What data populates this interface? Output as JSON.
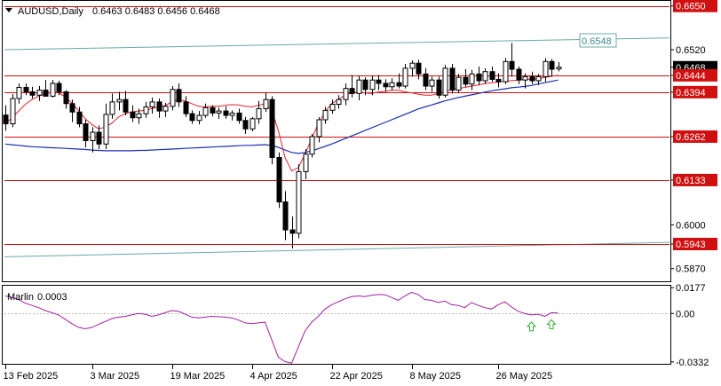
{
  "header": {
    "symbol": "AUDUSD,Daily",
    "ohlc": "0.6463 0.6483 0.6456 0.6468"
  },
  "indicator": {
    "name": "Marlin",
    "value": "0.0003",
    "color": "#a020a0"
  },
  "colors": {
    "bull": "#ffffff",
    "bear": "#000000",
    "ma_red": "#e0202a",
    "ma_blue": "#1a2fb0",
    "level_line": "#d01010",
    "channel": "#6aa8a8",
    "signal_arrow": "#30b030"
  },
  "chart_data": [
    {
      "type": "candlestick",
      "title": "AUDUSD,Daily",
      "ylim": [
        0.5835,
        0.6665
      ],
      "price_ticks": [
        "0.6650",
        "0.6520",
        "0.6468",
        "0.6444",
        "0.6394",
        "0.6262",
        "0.6133",
        "0.6000",
        "0.5943",
        "0.5870"
      ],
      "x_ticks": [
        "13 Feb 2025",
        "3 Mar 2025",
        "19 Mar 2025",
        "4 Apr 2025",
        "22 Apr 2025",
        "8 May 2025",
        "26 May 2025"
      ],
      "levels": [
        0.665,
        0.6444,
        0.6394,
        0.6262,
        0.6133,
        0.5943
      ],
      "channel_label": "0.6548",
      "current_price": "0.6468",
      "candles": [
        [
          0.6326,
          0.6355,
          0.628,
          0.63
        ],
        [
          0.63,
          0.6388,
          0.629,
          0.6375
        ],
        [
          0.6375,
          0.642,
          0.636,
          0.6408
        ],
        [
          0.6408,
          0.642,
          0.6385,
          0.6395
        ],
        [
          0.6395,
          0.641,
          0.6375,
          0.6385
        ],
        [
          0.6385,
          0.6412,
          0.6368,
          0.64
        ],
        [
          0.64,
          0.643,
          0.6385,
          0.6382
        ],
        [
          0.6382,
          0.643,
          0.6378,
          0.642
        ],
        [
          0.642,
          0.6428,
          0.6385,
          0.6395
        ],
        [
          0.6395,
          0.64,
          0.6345,
          0.636
        ],
        [
          0.636,
          0.6372,
          0.6305,
          0.6335
        ],
        [
          0.6335,
          0.635,
          0.629,
          0.63
        ],
        [
          0.63,
          0.6312,
          0.623,
          0.625
        ],
        [
          0.625,
          0.629,
          0.6215,
          0.6275
        ],
        [
          0.6275,
          0.6295,
          0.6225,
          0.624
        ],
        [
          0.624,
          0.636,
          0.6225,
          0.6328
        ],
        [
          0.6328,
          0.639,
          0.6315,
          0.6365
        ],
        [
          0.6365,
          0.6395,
          0.634,
          0.6372
        ],
        [
          0.6372,
          0.6398,
          0.6325,
          0.6335
        ],
        [
          0.6335,
          0.6355,
          0.6305,
          0.6318
        ],
        [
          0.6318,
          0.6345,
          0.63,
          0.633
        ],
        [
          0.633,
          0.6365,
          0.6318,
          0.635
        ],
        [
          0.635,
          0.6378,
          0.633,
          0.6365
        ],
        [
          0.6365,
          0.6375,
          0.6318,
          0.6338
        ],
        [
          0.6338,
          0.6362,
          0.632,
          0.6352
        ],
        [
          0.6352,
          0.6412,
          0.634,
          0.6402
        ],
        [
          0.6402,
          0.642,
          0.635,
          0.6365
        ],
        [
          0.6365,
          0.6382,
          0.632,
          0.633
        ],
        [
          0.633,
          0.634,
          0.63,
          0.631
        ],
        [
          0.631,
          0.6338,
          0.6298,
          0.6325
        ],
        [
          0.6325,
          0.636,
          0.6318,
          0.6348
        ],
        [
          0.6348,
          0.6355,
          0.6322,
          0.6332
        ],
        [
          0.6332,
          0.6348,
          0.6315,
          0.6338
        ],
        [
          0.6338,
          0.6352,
          0.6315,
          0.6325
        ],
        [
          0.6325,
          0.634,
          0.631,
          0.6332
        ],
        [
          0.6332,
          0.6345,
          0.63,
          0.631
        ],
        [
          0.631,
          0.632,
          0.627,
          0.6285
        ],
        [
          0.6285,
          0.632,
          0.6278,
          0.6315
        ],
        [
          0.6315,
          0.6368,
          0.63,
          0.6345
        ],
        [
          0.6345,
          0.6392,
          0.6335,
          0.6372
        ],
        [
          0.6372,
          0.6382,
          0.618,
          0.62
        ],
        [
          0.62,
          0.6215,
          0.605,
          0.6068
        ],
        [
          0.6068,
          0.61,
          0.5955,
          0.5985
        ],
        [
          0.5985,
          0.6025,
          0.593,
          0.5975
        ],
        [
          0.5975,
          0.618,
          0.596,
          0.6158
        ],
        [
          0.6158,
          0.6225,
          0.6135,
          0.621
        ],
        [
          0.621,
          0.627,
          0.62,
          0.6262
        ],
        [
          0.6262,
          0.632,
          0.6245,
          0.6312
        ],
        [
          0.6312,
          0.635,
          0.63,
          0.634
        ],
        [
          0.634,
          0.6372,
          0.633,
          0.6358
        ],
        [
          0.6358,
          0.6385,
          0.6345,
          0.6372
        ],
        [
          0.6372,
          0.642,
          0.6355,
          0.6405
        ],
        [
          0.6405,
          0.6445,
          0.6378,
          0.639
        ],
        [
          0.639,
          0.6442,
          0.637,
          0.643
        ],
        [
          0.643,
          0.6438,
          0.6385,
          0.6402
        ],
        [
          0.6402,
          0.6442,
          0.6385,
          0.643
        ],
        [
          0.643,
          0.6445,
          0.64,
          0.642
        ],
        [
          0.642,
          0.6432,
          0.6395,
          0.641
        ],
        [
          0.641,
          0.6435,
          0.64,
          0.6422
        ],
        [
          0.6422,
          0.645,
          0.6405,
          0.6412
        ],
        [
          0.6412,
          0.6478,
          0.6405,
          0.6465
        ],
        [
          0.6465,
          0.6488,
          0.644,
          0.648
        ],
        [
          0.648,
          0.649,
          0.6432,
          0.6448
        ],
        [
          0.6448,
          0.6465,
          0.64,
          0.6412
        ],
        [
          0.6412,
          0.644,
          0.6395,
          0.643
        ],
        [
          0.643,
          0.644,
          0.6375,
          0.6385
        ],
        [
          0.6385,
          0.6475,
          0.6378,
          0.6465
        ],
        [
          0.6465,
          0.6478,
          0.639,
          0.64
        ],
        [
          0.64,
          0.6448,
          0.6392,
          0.6438
        ],
        [
          0.6438,
          0.6462,
          0.641,
          0.6418
        ],
        [
          0.6418,
          0.646,
          0.64,
          0.6448
        ],
        [
          0.6448,
          0.647,
          0.6415,
          0.6428
        ],
        [
          0.6428,
          0.6465,
          0.6418,
          0.6455
        ],
        [
          0.6455,
          0.647,
          0.6425,
          0.6432
        ],
        [
          0.6432,
          0.645,
          0.6408,
          0.6425
        ],
        [
          0.6425,
          0.6495,
          0.6418,
          0.6485
        ],
        [
          0.6485,
          0.654,
          0.644,
          0.6462
        ],
        [
          0.6462,
          0.647,
          0.6418,
          0.643
        ],
        [
          0.643,
          0.645,
          0.6405,
          0.644
        ],
        [
          0.644,
          0.6455,
          0.6418,
          0.6428
        ],
        [
          0.6428,
          0.6448,
          0.6415,
          0.644
        ],
        [
          0.644,
          0.6495,
          0.6425,
          0.6485
        ],
        [
          0.6485,
          0.6492,
          0.644,
          0.6462
        ],
        [
          0.6463,
          0.6483,
          0.6456,
          0.6468
        ]
      ],
      "ma_red": [
        0.63,
        0.6318,
        0.6338,
        0.6358,
        0.6372,
        0.6382,
        0.6388,
        0.6395,
        0.6392,
        0.638,
        0.6362,
        0.634,
        0.6315,
        0.6298,
        0.6285,
        0.629,
        0.6302,
        0.632,
        0.633,
        0.6335,
        0.6338,
        0.634,
        0.6345,
        0.635,
        0.6354,
        0.6365,
        0.6372,
        0.6368,
        0.636,
        0.6352,
        0.635,
        0.6352,
        0.6352,
        0.6355,
        0.6357,
        0.6356,
        0.6352,
        0.635,
        0.6355,
        0.636,
        0.634,
        0.628,
        0.62,
        0.616,
        0.617,
        0.621,
        0.6255,
        0.63,
        0.6335,
        0.636,
        0.6372,
        0.6385,
        0.6392,
        0.6395,
        0.6392,
        0.639,
        0.6394,
        0.6396,
        0.64,
        0.64,
        0.6395,
        0.6392,
        0.6388,
        0.6385,
        0.6385,
        0.639,
        0.6395,
        0.6402,
        0.6405,
        0.6408,
        0.6412,
        0.6415,
        0.642,
        0.6422,
        0.6424,
        0.6426,
        0.6428,
        0.643,
        0.6432,
        0.6432,
        0.6434,
        0.6438,
        0.6441,
        0.6444
      ],
      "ma_blue": [
        0.624,
        0.6238,
        0.6236,
        0.6234,
        0.6232,
        0.6231,
        0.623,
        0.6229,
        0.6228,
        0.6227,
        0.6226,
        0.6225,
        0.6224,
        0.6222,
        0.6221,
        0.622,
        0.622,
        0.622,
        0.622,
        0.622,
        0.6221,
        0.6221,
        0.6222,
        0.6223,
        0.6224,
        0.6225,
        0.6226,
        0.6227,
        0.6228,
        0.6229,
        0.623,
        0.6231,
        0.6232,
        0.6233,
        0.6234,
        0.6235,
        0.6236,
        0.6236,
        0.6237,
        0.6238,
        0.6236,
        0.623,
        0.6222,
        0.6215,
        0.6212,
        0.6215,
        0.622,
        0.6226,
        0.6233,
        0.624,
        0.6248,
        0.6256,
        0.6264,
        0.6272,
        0.628,
        0.6288,
        0.6296,
        0.6304,
        0.6312,
        0.632,
        0.6328,
        0.6336,
        0.6344,
        0.635,
        0.6356,
        0.6362,
        0.6368,
        0.6373,
        0.6378,
        0.6382,
        0.6386,
        0.639,
        0.6394,
        0.6398,
        0.6401,
        0.6404,
        0.6407,
        0.6409,
        0.6411,
        0.6414,
        0.6418,
        0.6422,
        0.6426,
        0.643
      ],
      "channel_upper": [
        0.652,
        0.6555
      ],
      "channel_lower": [
        0.5905,
        0.5948
      ]
    },
    {
      "type": "line",
      "title": "Marlin 0.0003",
      "ylim": [
        -0.0345,
        0.019
      ],
      "y_ticks": [
        "0.0177",
        "0.00",
        "-0.0332"
      ],
      "values": [
        0.012,
        0.011,
        0.0095,
        0.007,
        0.0055,
        0.004,
        0.002,
        0.0005,
        -0.001,
        -0.004,
        -0.007,
        -0.0095,
        -0.0105,
        -0.0095,
        -0.0075,
        -0.0055,
        -0.0035,
        -0.0025,
        -0.002,
        -0.001,
        0.0,
        -0.0005,
        -0.002,
        -0.001,
        0.0005,
        0.002,
        0.0015,
        -0.0005,
        -0.0025,
        -0.003,
        -0.0025,
        -0.002,
        -0.0022,
        -0.0025,
        -0.003,
        -0.0045,
        -0.0065,
        -0.007,
        -0.0065,
        -0.006,
        -0.018,
        -0.03,
        -0.033,
        -0.034,
        -0.023,
        -0.012,
        -0.006,
        -0.002,
        0.003,
        0.006,
        0.008,
        0.01,
        0.0115,
        0.012,
        0.0115,
        0.0125,
        0.013,
        0.0128,
        0.011,
        0.009,
        0.012,
        0.0145,
        0.013,
        0.0095,
        0.009,
        0.0075,
        0.0085,
        0.006,
        0.0055,
        0.004,
        0.0075,
        0.0055,
        0.004,
        0.003,
        0.006,
        0.008,
        0.0045,
        0.0015,
        0.0,
        -0.001,
        -0.0005,
        -0.002,
        0.0005,
        0.0003
      ],
      "arrow_indices": [
        79,
        82
      ]
    }
  ]
}
